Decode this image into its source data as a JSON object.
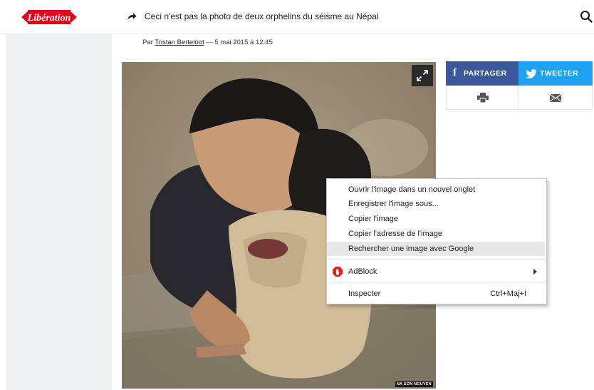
{
  "header": {
    "logo_text": "Libération",
    "headline": "Ceci n'est pas la photo de deux orphelins du séisme au Népal"
  },
  "article": {
    "byline_prefix": "Par ",
    "author": "Tristan Berteloot",
    "byline_suffix": " — 5 mai 2015 à 12:45",
    "photo_credit": "NA SON NGUYEN"
  },
  "share": {
    "facebook_label": "PARTAGER",
    "twitter_label": "TWEETER",
    "facebook_color": "#3b5998",
    "twitter_color": "#1da1f2"
  },
  "context_menu": {
    "items": [
      {
        "label": "Ouvrir l'image dans un nouvel onglet"
      },
      {
        "label": "Enregistrer l'image sous..."
      },
      {
        "label": "Copier l'image"
      },
      {
        "label": "Copier l'adresse de l'image"
      },
      {
        "label": "Rechercher une image avec Google",
        "highlighted": true
      },
      {
        "label": "AdBlock",
        "icon": "adblock-icon",
        "submenu": true
      },
      {
        "label": "Inspecter",
        "shortcut": "Ctrl+Maj+I"
      }
    ]
  }
}
